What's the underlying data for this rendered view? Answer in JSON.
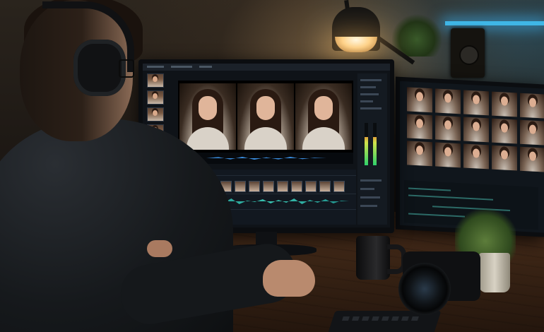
{
  "scene": {
    "description_visible_text": ""
  },
  "colors": {
    "accent_audio_blue": "#3a8ee0",
    "accent_audio_teal": "#39c2b0",
    "lamp_glow": "#ffd38a",
    "shelf_glow": "#3fb6e6",
    "meter_green": "#2fd26b"
  },
  "icons": [
    "desk-lamp",
    "headphones",
    "keyboard",
    "mug",
    "camera",
    "plant",
    "speaker"
  ]
}
